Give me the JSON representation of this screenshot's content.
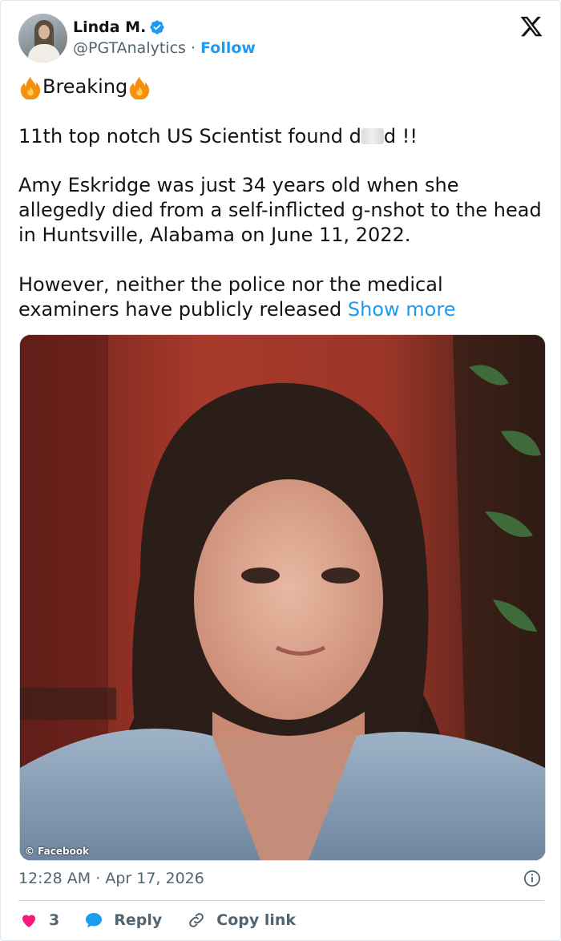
{
  "author": {
    "name": "Linda M.",
    "handle": "@PGTAnalytics",
    "separator": "·",
    "follow_label": "Follow",
    "verified_color": "#1d9bf0"
  },
  "tweet": {
    "headline": "Breaking",
    "line1_start": "11th top notch US Scientist found d",
    "line1_end": "d !!",
    "para2": "Amy Eskridge was just 34 years old when she allegedly died from a self-inflicted g-nshot to the head in Huntsville, Alabama on June 11, 2022.",
    "para3": "However, neither the police nor the medical examiners have publicly released",
    "show_more": "Show more"
  },
  "media": {
    "watermark": "© Facebook"
  },
  "meta": {
    "time": "12:28 AM",
    "separator": "·",
    "date": "Apr 17, 2026"
  },
  "actions": {
    "likes": "3",
    "reply_label": "Reply",
    "copy_label": "Copy link"
  },
  "colors": {
    "accent": "#1d9bf0",
    "like": "#f91880",
    "secondary_text": "#536471"
  },
  "icons": [
    "verified-badge-icon",
    "x-logo-icon",
    "fire-emoji-icon",
    "info-icon",
    "heart-icon",
    "reply-bubble-icon",
    "link-icon"
  ]
}
